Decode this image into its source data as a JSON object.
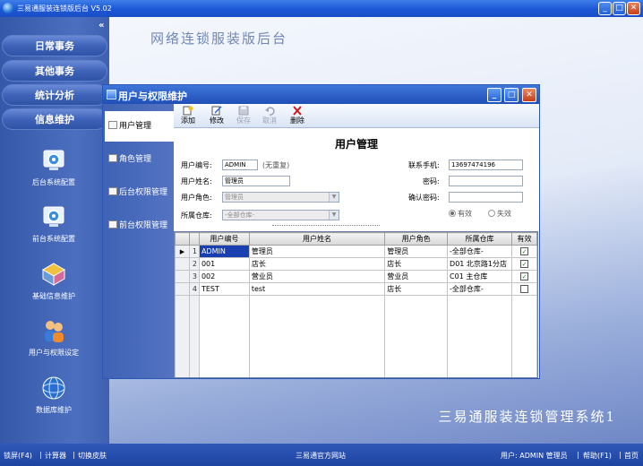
{
  "window": {
    "title": "三易通服装连锁版后台 V5.02",
    "min": "_",
    "max": "□",
    "close": "✕"
  },
  "nav": {
    "collapse": "«",
    "menus": [
      "日常事务",
      "其他事务",
      "统计分析",
      "信息维护"
    ],
    "tools": [
      {
        "label": "后台系统配置",
        "icon": "gear-monitor-icon"
      },
      {
        "label": "前台系统配置",
        "icon": "gear-monitor-icon"
      },
      {
        "label": "基础信息维护",
        "icon": "blocks-icon"
      },
      {
        "label": "用户与权限设定",
        "icon": "users-icon"
      },
      {
        "label": "数据库维护",
        "icon": "globe-icon"
      }
    ]
  },
  "workspace": {
    "banner": "网络连锁服装版后台",
    "footer_title": "三易通服装连锁管理系统1"
  },
  "dialog": {
    "title": "用户与权限维护",
    "tabs": [
      "用户管理",
      "角色管理",
      "后台权限管理",
      "前台权限管理"
    ],
    "toolbar": {
      "add": "添加",
      "edit": "修改",
      "save": "保存",
      "cancel": "取消",
      "delete": "删除"
    },
    "form": {
      "title": "用户管理",
      "user_id_label": "用户编号:",
      "user_id_value": "ADMIN",
      "no_repeat": "(无重复)",
      "user_name_label": "用户姓名:",
      "user_name_value": "管理员",
      "role_label": "用户角色:",
      "role_value": "管理员",
      "warehouse_label": "所属仓库:",
      "warehouse_value": "-全部仓库-",
      "phone_label": "联系手机:",
      "phone_value": "13697474196",
      "password_label": "密码:",
      "password_value": "",
      "confirm_label": "确认密码:",
      "confirm_value": "",
      "valid_label": "有效",
      "invalid_label": "失效"
    },
    "grid": {
      "headers": [
        "用户编号",
        "用户姓名",
        "用户角色",
        "所属仓库",
        "有效"
      ],
      "rows": [
        {
          "n": "1",
          "id": "ADMIN",
          "name": "管理员",
          "role": "管理员",
          "wh": "-全部仓库-",
          "valid": true
        },
        {
          "n": "2",
          "id": "001",
          "name": "店长",
          "role": "店长",
          "wh": "D01 北京路1分店",
          "valid": true
        },
        {
          "n": "3",
          "id": "002",
          "name": "营业员",
          "role": "营业员",
          "wh": "C01 主仓库",
          "valid": true
        },
        {
          "n": "4",
          "id": "TEST",
          "name": "test",
          "role": "店长",
          "wh": "-全部仓库-",
          "valid": false
        }
      ]
    }
  },
  "status": {
    "lock": "锁屏(F4)",
    "calc": "计算器",
    "skin": "切换皮肤",
    "site": "三易通官方网站",
    "user": "用户: ADMIN 管理员",
    "help": "帮助(F1)",
    "home": "首页"
  }
}
